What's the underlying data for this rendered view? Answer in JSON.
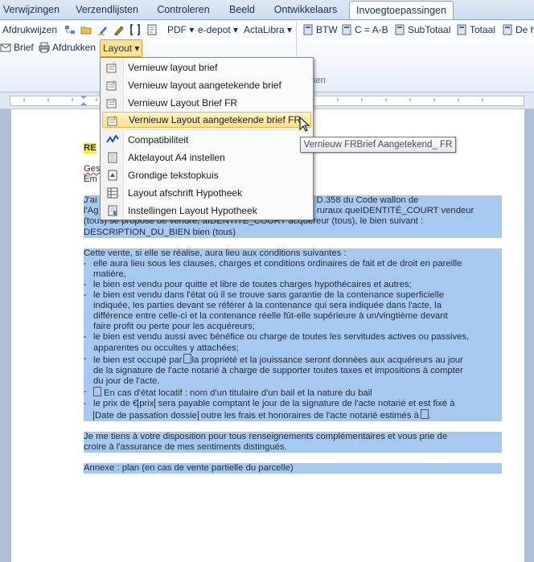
{
  "tabs": [
    "Verwijzingen",
    "Verzendlijsten",
    "Controleren",
    "Beeld",
    "Ontwikkelaars",
    "Invoegtoepassingen"
  ],
  "active_tab": "Invoegtoepassingen",
  "ribbon": {
    "row1_left": [
      "Afdrukwijzen"
    ],
    "pdf": "PDF",
    "edepot": "e-depot",
    "actalibra": "ActaLibra",
    "btw": "BTW",
    "cab": "C = A-B",
    "subtotaal": "SubTotaal",
    "totaal": "Totaal",
    "de": "De h",
    "brief": "Brief",
    "afdrukken": "Afdrukken",
    "layout": "Layout",
    "group_label": "ken"
  },
  "menu": {
    "items": [
      {
        "label": "Vernieuw layout brief",
        "icon": "layout-refresh-icon"
      },
      {
        "label": "Vernieuw layout aangetekende brief",
        "icon": "layout-refresh-icon"
      },
      {
        "label": "Vernieuw Layout Brief FR",
        "icon": "layout-refresh-icon"
      },
      {
        "label": "Vernieuw Layout aangetekende brief FR",
        "icon": "layout-refresh-icon"
      },
      {
        "label": "Compatibiliteit",
        "icon": "compatibility-icon"
      },
      {
        "label": "Aktelayout A4 instellen",
        "icon": "document-icon"
      },
      {
        "label": "Grondige tekstopkuis",
        "icon": "cleanup-icon"
      },
      {
        "label": "Layout afschrift Hypotheek",
        "icon": "table-icon"
      },
      {
        "label": "Instellingen Layout Hypotheek",
        "icon": "settings-doc-icon"
      }
    ],
    "tooltip": "Vernieuw FRBrief Aangetekend_ FR"
  },
  "document": {
    "heading_fragment": "RE",
    "line_ges": "Ges",
    "line_em": "Em",
    "p1": [
      "J'ai",
      "cution de l'article D.358 du Code wallon de",
      "l'Ag",
      "ens ruraux que",
      "IDENTITÉ_COURT vendeur",
      "(tous) se propose de vendre, a",
      "IDENTITE_COURT acquéreur (tous), le bien suivant :",
      "DESCRIPTION_DU_BIEN bien (tous)"
    ],
    "p2_intro": "Cette vente, si elle se réalise, aura lieu aux conditions suivantes :",
    "bullets": [
      [
        "elle aura lieu sous les clauses, charges et conditions ordinaires de fait et de droit en pareille",
        "matière,"
      ],
      [
        "le bien est vendu pour quitte et libre de toutes charges hypothécaires et autres;"
      ],
      [
        "le bien est vendu dans l'état où il se trouve sans garantie de la contenance superficielle",
        "indiquée, les parties devant se référer à la contenance qui sera indiquée dans l'acte, la",
        "différence entre celle-ci et la contenance réelle fût-elle supérieure à un/vingtième devant",
        "faire profit ou perte pour les acquéreurs;"
      ],
      [
        "le bien est vendu aussi avec bénéfice ou charge de toutes les servitudes actives ou passives,",
        "apparentes ou occultes y attachées;"
      ],
      [
        "le bien est occupé par",
        "la propriété et la jouissance seront données aux acquéreurs au jour",
        "de la signature de l'acte notarié à charge de supporter toutes taxes et impositions à compter",
        "du jour de l'acte."
      ],
      [
        "En cas d'état locatif : nom d'un titulaire d'un bail et la nature du bail"
      ],
      [
        "le prix de €",
        "prix",
        "sera payable comptant le jour de la signature de l'acte notarié et est fixé à",
        "Date de passation dossie",
        "outre les frais et honoraires de l'acte notarié estimés à",
        "."
      ]
    ],
    "p3": [
      "Je me tiens à votre disposition pour tous renseignements complémentaires et vous prie de",
      "croire à l'assurance de mes sentiments distingués."
    ],
    "annexe": "Annexe : plan (en cas de vente partielle du parcelle)"
  },
  "colors": {
    "selection": "#a8c9ef",
    "menu_hover": "#ffe08a",
    "ribbon_text": "#15325c"
  }
}
